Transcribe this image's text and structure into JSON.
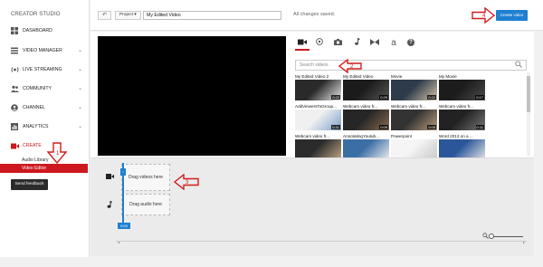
{
  "sidebar": {
    "title": "CREATOR STUDIO",
    "items": [
      {
        "label": "DASHBOARD",
        "icon": "dashboard-icon",
        "chevron": false
      },
      {
        "label": "VIDEO MANAGER",
        "icon": "video-manager-icon",
        "chevron": true
      },
      {
        "label": "LIVE STREAMING",
        "icon": "live-streaming-icon",
        "chevron": true
      },
      {
        "label": "COMMUNITY",
        "icon": "community-icon",
        "chevron": true
      },
      {
        "label": "CHANNEL",
        "icon": "channel-icon",
        "chevron": true
      },
      {
        "label": "ANALYTICS",
        "icon": "analytics-icon",
        "chevron": true
      },
      {
        "label": "CREATE",
        "icon": "create-icon",
        "chevron": false
      }
    ],
    "sub_items": [
      {
        "label": "Audio Library",
        "active": false
      },
      {
        "label": "Video Editor",
        "active": true
      }
    ],
    "feedback_label": "Send feedback"
  },
  "toolbar": {
    "undo_symbol": "↶",
    "project_label": "Project",
    "project_chevron": "▾",
    "title_value": "My Edited Video",
    "status": "All changes saved.",
    "create_label": "Create video"
  },
  "media": {
    "tabs": [
      "video-camera-icon",
      "photo-icon",
      "camera-icon",
      "music-icon",
      "transition-icon",
      "text-icon",
      "help-icon"
    ],
    "text_tab_glyph": "a",
    "help_tab_glyph": "?",
    "search_placeholder": "Search videos",
    "thumbnails": [
      {
        "title": "My Edited Video 2",
        "duration": "0:22"
      },
      {
        "title": "My Edited Video",
        "duration": "0:29"
      },
      {
        "title": "Movie",
        "duration": "0:22"
      },
      {
        "title": "My Movie",
        "duration": "0:17"
      },
      {
        "title": "AddViewersToGroup...",
        "duration": "0:31"
      },
      {
        "title": "Webcam video fr...",
        "duration": "0:09"
      },
      {
        "title": "Webcam video fr...",
        "duration": "0:05"
      },
      {
        "title": "Webcam video fr...",
        "duration": "0:11"
      },
      {
        "title": "Webcam video fr...",
        "duration": ""
      },
      {
        "title": "AnnotatingYoutub...",
        "duration": ""
      },
      {
        "title": "Powerpoint",
        "duration": ""
      },
      {
        "title": "Word 2013 on a ...",
        "duration": ""
      }
    ]
  },
  "timeline": {
    "video_drop_label": "Drag videos here",
    "audio_drop_label": "Drag audio here",
    "time_label": "0:00"
  },
  "annotations": [
    "1",
    "2",
    "3",
    "4"
  ],
  "colors": {
    "accent_red": "#cc181e",
    "accent_blue": "#1f7fd1",
    "annotation_red": "#d21d1d"
  }
}
